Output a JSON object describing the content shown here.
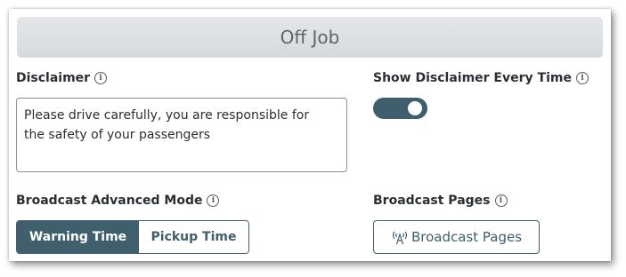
{
  "header": {
    "title": "Off Job"
  },
  "disclaimer": {
    "label": "Disclaimer",
    "value": "Please drive carefully, you are responsible for\nthe safety of your passengers"
  },
  "show_disclaimer": {
    "label": "Show Disclaimer Every Time",
    "enabled": true
  },
  "broadcast_mode": {
    "label": "Broadcast Advanced Mode",
    "options": [
      "Warning Time",
      "Pickup Time"
    ],
    "selected": "Warning Time"
  },
  "broadcast_pages": {
    "label": "Broadcast Pages",
    "button_label": "Broadcast Pages",
    "icon": "broadcast-icon"
  },
  "info_glyph": "i",
  "colors": {
    "accent": "#3e5f6b",
    "header_bg": "#dcdfe2",
    "header_text": "#5d646a"
  }
}
